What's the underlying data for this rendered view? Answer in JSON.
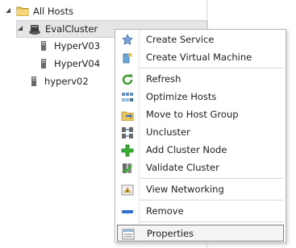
{
  "tree": {
    "root_label": "All Hosts",
    "cluster_label": "EvalCluster",
    "cluster_hosts": [
      "HyperV03",
      "HyperV04"
    ],
    "standalone_host": "hyperv02"
  },
  "context_menu": {
    "items": [
      {
        "label": "Create Service",
        "icon": "create-service-icon"
      },
      {
        "label": "Create Virtual Machine",
        "icon": "create-vm-icon"
      },
      {
        "label": "Refresh",
        "icon": "refresh-icon"
      },
      {
        "label": "Optimize Hosts",
        "icon": "optimize-hosts-icon"
      },
      {
        "label": "Move to Host Group",
        "icon": "move-folder-icon"
      },
      {
        "label": "Uncluster",
        "icon": "uncluster-icon"
      },
      {
        "label": "Add Cluster Node",
        "icon": "add-node-icon"
      },
      {
        "label": "Validate Cluster",
        "icon": "validate-cluster-icon"
      },
      {
        "label": "View Networking",
        "icon": "view-networking-icon"
      },
      {
        "label": "Remove",
        "icon": "remove-icon"
      },
      {
        "label": "Properties",
        "icon": "properties-icon"
      }
    ]
  },
  "colors": {
    "folder": "#e8c558",
    "refresh_green": "#3a9a2a",
    "add_green": "#35b12e",
    "remove_blue": "#2e6fd6",
    "highlight_border": "#7a7a7a"
  }
}
